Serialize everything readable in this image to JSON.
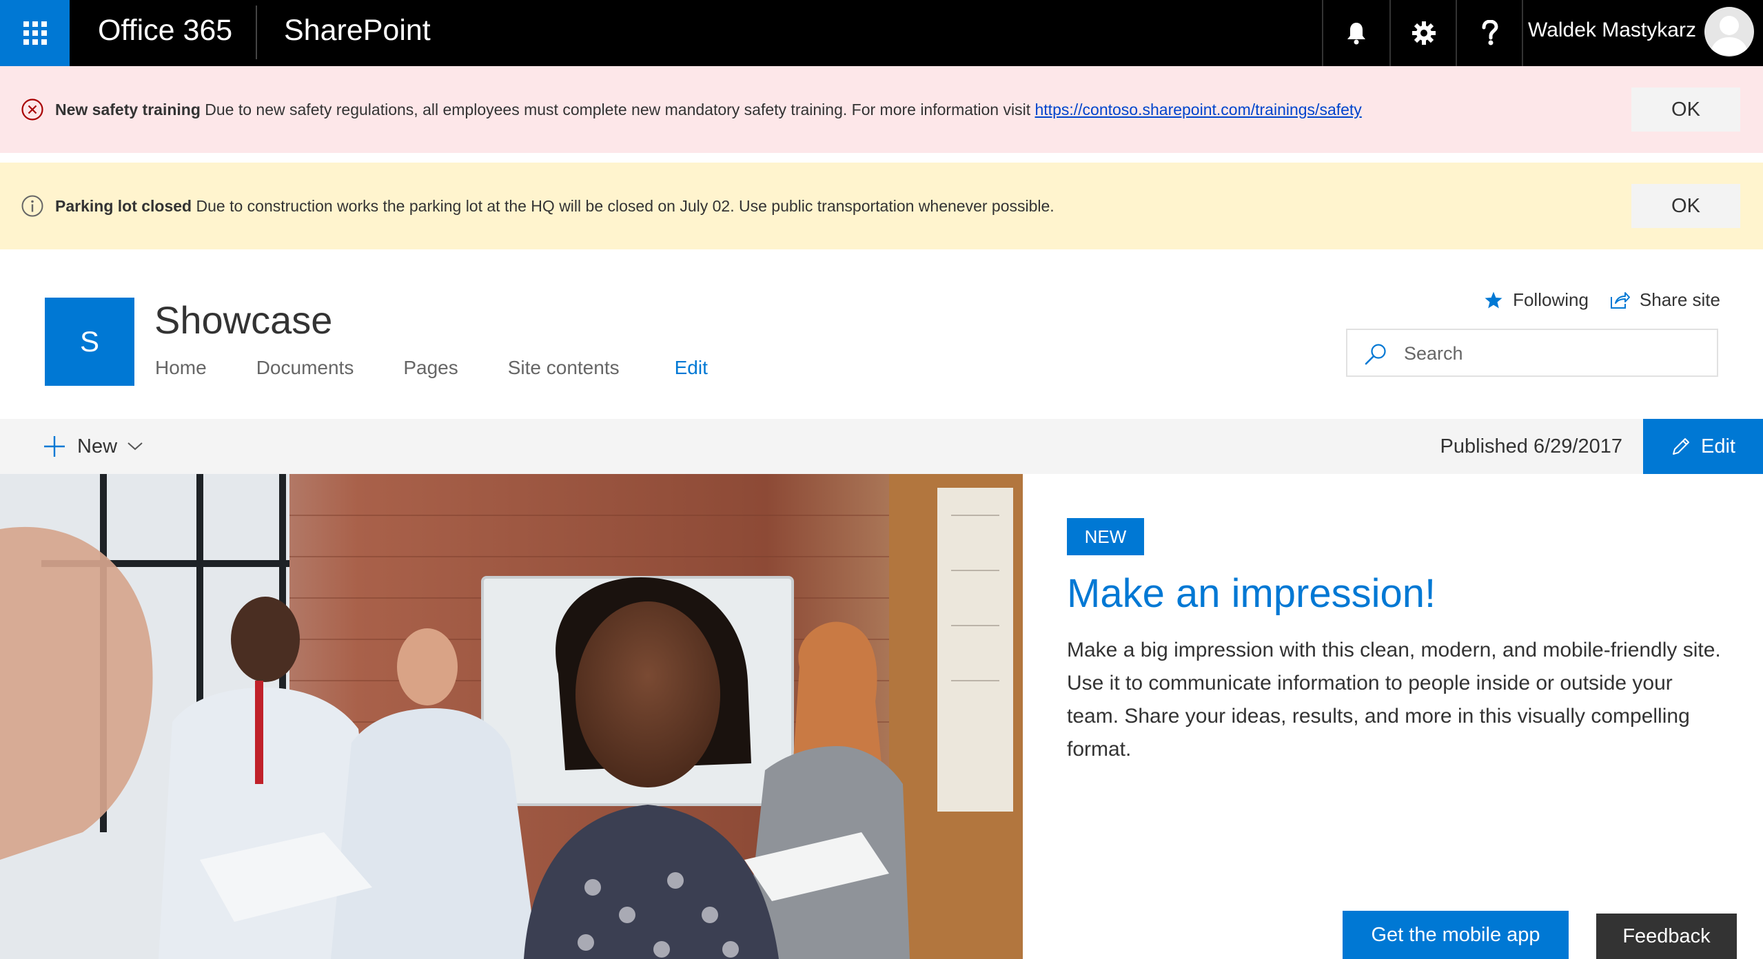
{
  "suite": {
    "app_name": "Office 365",
    "product_name": "SharePoint",
    "user_name": "Waldek Mastykarz",
    "icons": [
      "waffle-icon",
      "bell-icon",
      "gear-icon",
      "help-icon"
    ],
    "accent": "#0078d4"
  },
  "notifications": [
    {
      "severity": "error",
      "color": "#fde7e9",
      "title": "New safety training",
      "message": "Due to new safety regulations, all employees must complete new mandatory safety training. For more information visit",
      "link": "https://contoso.sharepoint.com/trainings/safety",
      "ok_label": "OK"
    },
    {
      "severity": "info",
      "color": "#fff4ce",
      "title": "Parking lot closed",
      "message": "Due to construction works the parking lot at the HQ will be closed on July 02. Use public transportation whenever possible.",
      "ok_label": "OK"
    }
  ],
  "site": {
    "logo_letter": "S",
    "title": "Showcase",
    "nav": [
      "Home",
      "Documents",
      "Pages",
      "Site contents"
    ],
    "nav_edit": "Edit",
    "following_label": "Following",
    "share_label": "Share site",
    "search_placeholder": "Search"
  },
  "command_bar": {
    "new_label": "New",
    "published": "Published 6/29/2017",
    "edit_label": "Edit"
  },
  "hero": {
    "badge": "NEW",
    "title": "Make an impression!",
    "description": "Make a big impression with this clean, modern, and mobile-friendly site. Use it to communicate information to people inside or outside your team. Share your ideas, results, and more in this visually compelling format."
  },
  "footer_buttons": {
    "mobile_app": "Get the mobile app",
    "feedback": "Feedback"
  }
}
